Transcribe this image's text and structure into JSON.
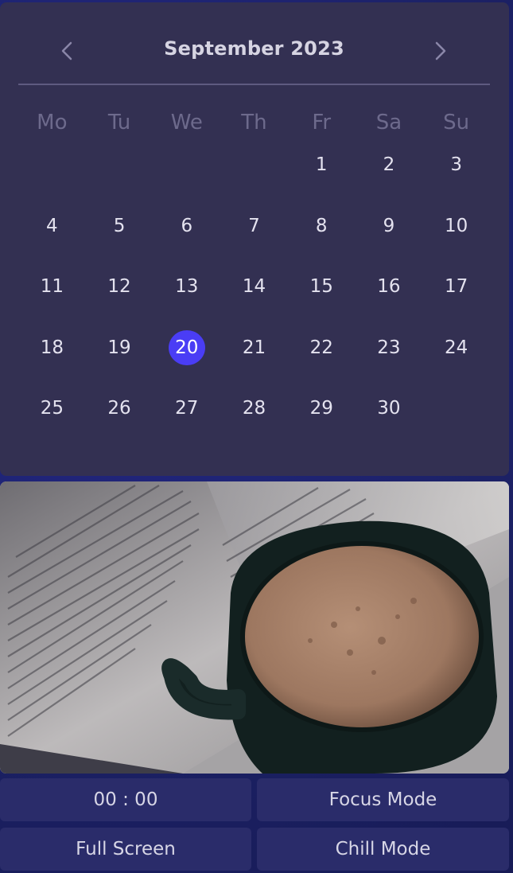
{
  "calendar": {
    "title": "September 2023",
    "weekdays": [
      "Mo",
      "Tu",
      "We",
      "Th",
      "Fr",
      "Sa",
      "Su"
    ],
    "days": [
      "",
      "",
      "",
      "",
      "1",
      "2",
      "3",
      "4",
      "5",
      "6",
      "7",
      "8",
      "9",
      "10",
      "11",
      "12",
      "13",
      "14",
      "15",
      "16",
      "17",
      "18",
      "19",
      "20",
      "21",
      "22",
      "23",
      "24",
      "25",
      "26",
      "27",
      "28",
      "29",
      "30",
      ""
    ],
    "selected_day": "20",
    "prev_icon": "chevron-left-icon",
    "next_icon": "chevron-right-icon"
  },
  "photo": {
    "description_icon": "coffee-book-image"
  },
  "controls": {
    "timer": "00 : 00",
    "focus_mode": "Focus Mode",
    "full_screen": "Full Screen",
    "chill_mode": "Chill Mode"
  },
  "colors": {
    "panel": "#333052",
    "accent": "#4a3df5",
    "background": "#1e2370",
    "button": "#2a2c6a"
  }
}
